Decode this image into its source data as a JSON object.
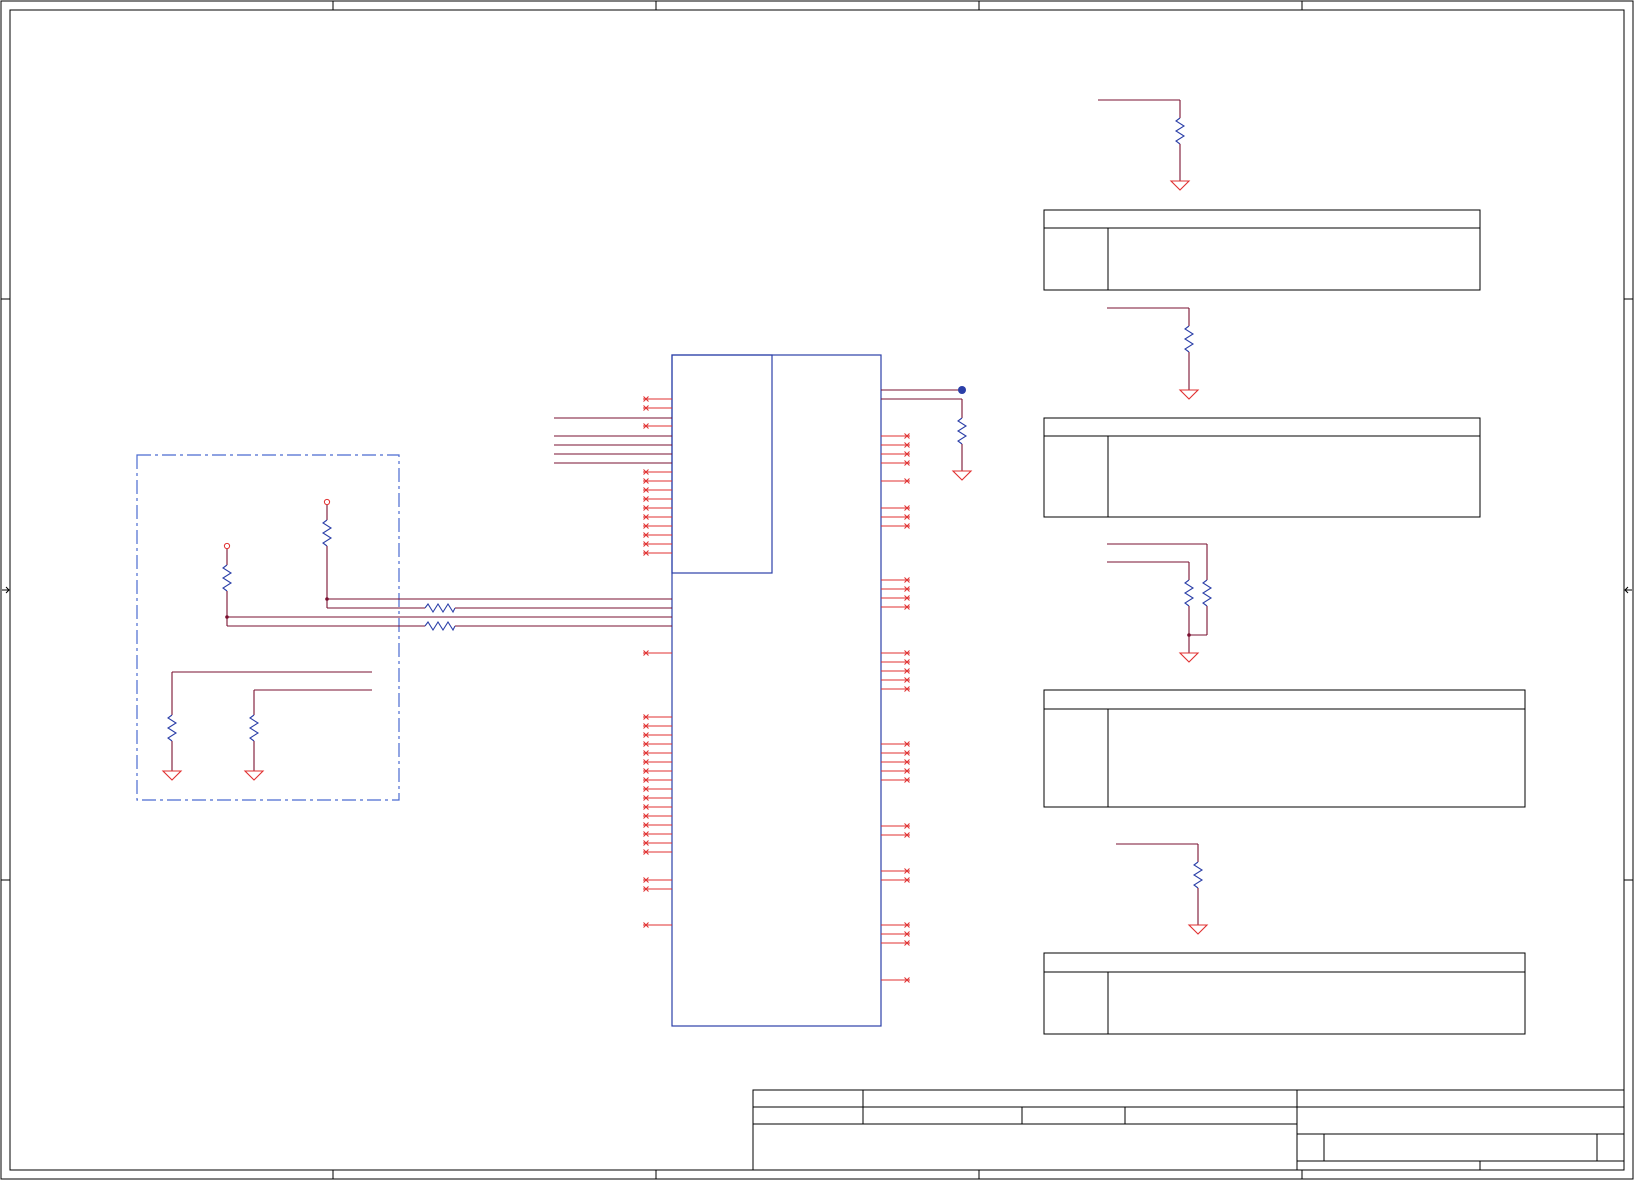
{
  "colors": {
    "frame": "#000000",
    "component": "#2b3fa8",
    "wire": "#7a1030",
    "pin": "#e03030",
    "ground": "#e03030",
    "resistor": "#2b3fa8",
    "junction": "#2b3fa8",
    "group_box": "#4a6ad0",
    "background": "#ffffff"
  },
  "sheet": {
    "border_zones_horizontal": 5,
    "border_zones_vertical": 4
  },
  "ic": {
    "left_pin_count": 46,
    "right_pin_count": 44,
    "unconnected_pin_marker": "x"
  },
  "config_blocks": {
    "count": 4
  },
  "title_block": {
    "present": true
  }
}
